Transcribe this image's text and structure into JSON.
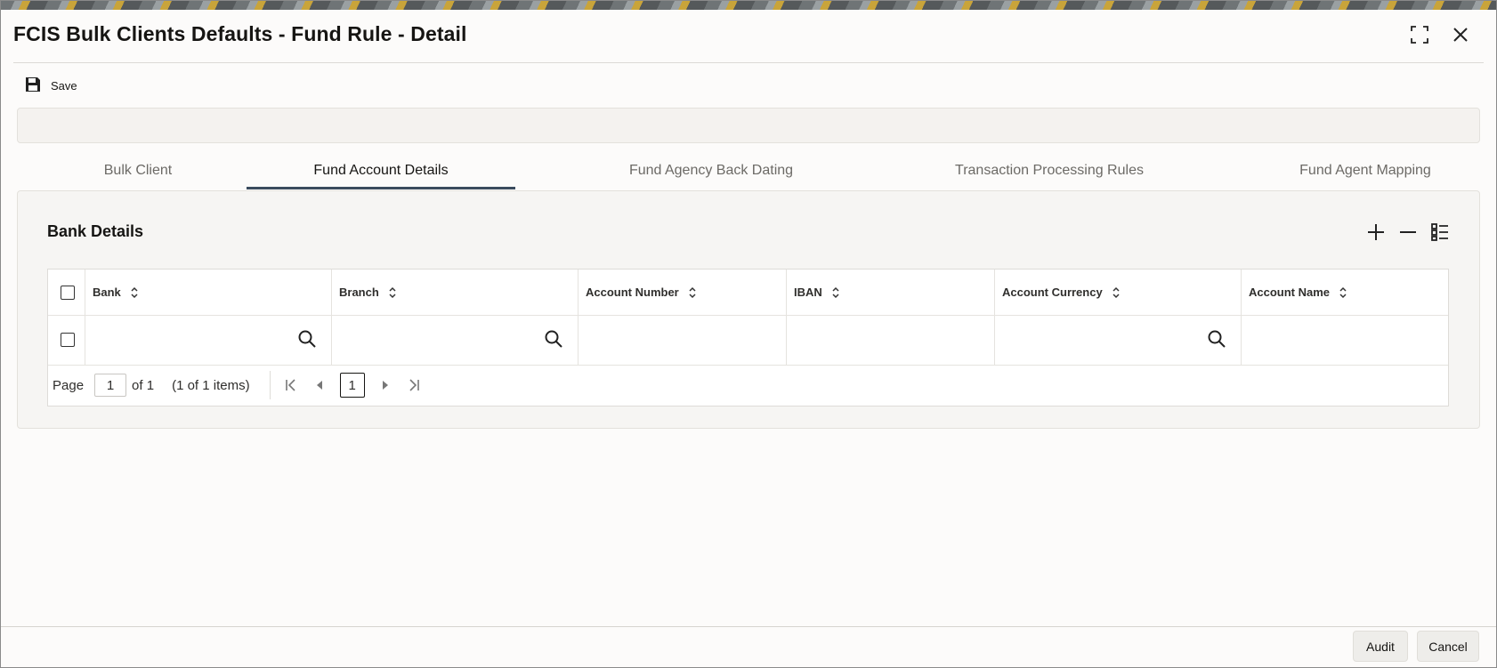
{
  "window": {
    "title": "FCIS Bulk Clients Defaults - Fund Rule - Detail"
  },
  "toolbar": {
    "save_label": "Save"
  },
  "tabs": [
    {
      "label": "Bulk Client",
      "active": false
    },
    {
      "label": "Fund Account Details",
      "active": true
    },
    {
      "label": "Fund Agency Back Dating",
      "active": false
    },
    {
      "label": "Transaction Processing Rules",
      "active": false
    },
    {
      "label": "Fund Agent Mapping",
      "active": false
    }
  ],
  "section": {
    "title": "Bank Details"
  },
  "table": {
    "columns": [
      "Bank",
      "Branch",
      "Account Number",
      "IBAN",
      "Account Currency",
      "Account Name"
    ],
    "rows": [
      {
        "bank": "",
        "branch": "",
        "account_number": "",
        "iban": "",
        "account_currency": "",
        "account_name": ""
      }
    ]
  },
  "pagination": {
    "page_label": "Page",
    "page_value": "1",
    "of_label": "of 1",
    "items_label": "(1 of 1 items)",
    "current_page": "1"
  },
  "footer": {
    "audit_label": "Audit",
    "cancel_label": "Cancel"
  },
  "colors": {
    "active_tab_underline": "#3a4b5e",
    "text": "#161513",
    "muted_text": "#6c6a66"
  }
}
